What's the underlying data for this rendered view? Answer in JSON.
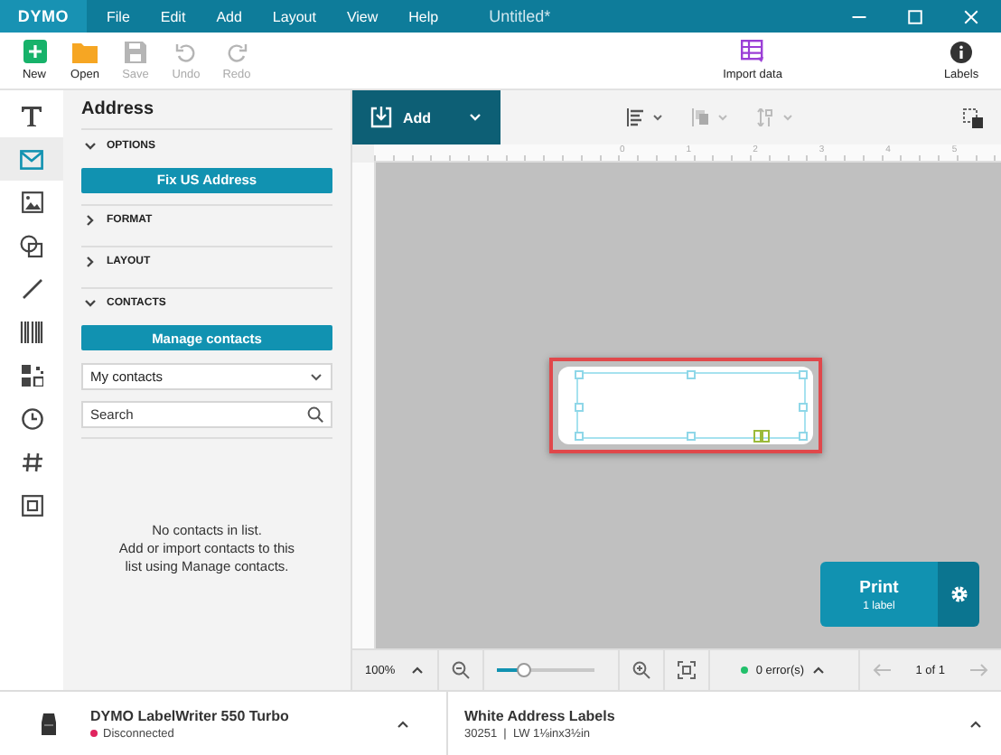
{
  "window": {
    "logo": "DYMO",
    "title": "Untitled*"
  },
  "menu": [
    "File",
    "Edit",
    "Add",
    "Layout",
    "View",
    "Help"
  ],
  "toolbar": [
    {
      "kind": "new",
      "label": "New",
      "disabled": false
    },
    {
      "kind": "open",
      "label": "Open",
      "disabled": false
    },
    {
      "kind": "save",
      "label": "Save",
      "disabled": true
    },
    {
      "kind": "undo",
      "label": "Undo",
      "disabled": true
    },
    {
      "kind": "redo",
      "label": "Redo",
      "disabled": true
    }
  ],
  "import_button": {
    "label": "Import data"
  },
  "labels_button": {
    "label": "Labels"
  },
  "tool_rail": [
    {
      "kind": "text",
      "selected": false
    },
    {
      "kind": "address",
      "selected": true
    },
    {
      "kind": "image",
      "selected": false
    },
    {
      "kind": "shapes",
      "selected": false
    },
    {
      "kind": "line",
      "selected": false
    },
    {
      "kind": "barcode",
      "selected": false
    },
    {
      "kind": "qr",
      "selected": false
    },
    {
      "kind": "clock",
      "selected": false
    },
    {
      "kind": "counter",
      "selected": false
    },
    {
      "kind": "frame",
      "selected": false
    }
  ],
  "panel": {
    "title": "Address",
    "sections": [
      {
        "title": "OPTIONS",
        "expanded": true,
        "button": "Fix US Address"
      },
      {
        "title": "FORMAT",
        "expanded": false
      },
      {
        "title": "LAYOUT",
        "expanded": false
      },
      {
        "title": "CONTACTS",
        "expanded": true,
        "button": "Manage contacts",
        "dropdown": "My contacts",
        "search": {
          "placeholder": "Search"
        }
      }
    ],
    "empty_message": "No contacts in list.\nAdd or import contacts to this list using Manage contacts."
  },
  "canvas_toolbar": {
    "add_button": "Add"
  },
  "ruler": [
    "0",
    "1",
    "2",
    "3",
    "4",
    "5"
  ],
  "print": {
    "label": "Print",
    "sublabel": "1 label"
  },
  "bottom_bar": {
    "zoom": "100%",
    "zoom_slider": {
      "level": 0.28
    },
    "errors": {
      "text": "0 error(s)",
      "color": "#22c06b"
    },
    "page": "1 of 1"
  },
  "status": {
    "printer": "DYMO LabelWriter 550 Turbo",
    "printer_state": {
      "text": "Disconnected",
      "color": "#e0245e"
    },
    "label_name": "White Address Labels",
    "label_info": "30251  |  LW 1⅛inx3½in"
  }
}
